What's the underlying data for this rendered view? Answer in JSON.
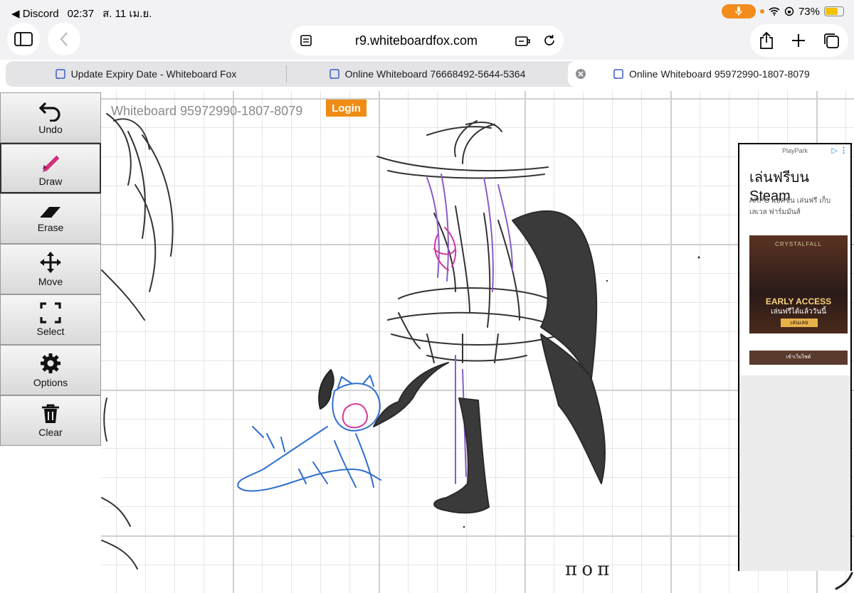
{
  "status_bar": {
    "back_app": "Discord",
    "time": "02:37",
    "date": "ส. 11 เม.ย.",
    "battery_level": 0.73,
    "battery": "73%"
  },
  "browser": {
    "url": "r9.whiteboardfox.com",
    "tabs": [
      {
        "title": "Update Expiry Date - Whiteboard Fox"
      },
      {
        "title": "Online Whiteboard 76668492-5644-5364"
      },
      {
        "title": "Online Whiteboard 95972990-1807-8079",
        "active": true
      }
    ]
  },
  "whiteboard": {
    "title": "Whiteboard 95972990-1807-8079",
    "login_label": "Login",
    "tools": [
      {
        "label": "Undo",
        "icon": "undo-icon"
      },
      {
        "label": "Draw",
        "icon": "pencil-icon",
        "active": true
      },
      {
        "label": "Erase",
        "icon": "eraser-icon"
      },
      {
        "label": "Move",
        "icon": "move-icon"
      },
      {
        "label": "Select",
        "icon": "select-icon"
      },
      {
        "label": "Options",
        "icon": "gear-icon"
      },
      {
        "label": "Clear",
        "icon": "trash-icon"
      }
    ],
    "signature": "π o π"
  },
  "ad": {
    "brand": "PlayPark",
    "headline": "เล่นฟรีบน Steam",
    "description": "ARPG แอคชัน เล่นฟรี เก็บเลเวล ฟาร์มมันส์",
    "game_logo": "CRYSTALFALL",
    "banner_title": "EARLY ACCESS",
    "banner_subtitle": "เล่นฟรีได้แล้ววันนี้",
    "banner_button": "เล่นเลย",
    "cta": "เข้าเว็บไซต์"
  },
  "colors": {
    "accent_orange": "#f08c14",
    "ink_black": "#333333",
    "ink_purple": "#8a5cc8",
    "ink_magenta": "#d03a9a",
    "ink_blue": "#2f6fd0"
  }
}
